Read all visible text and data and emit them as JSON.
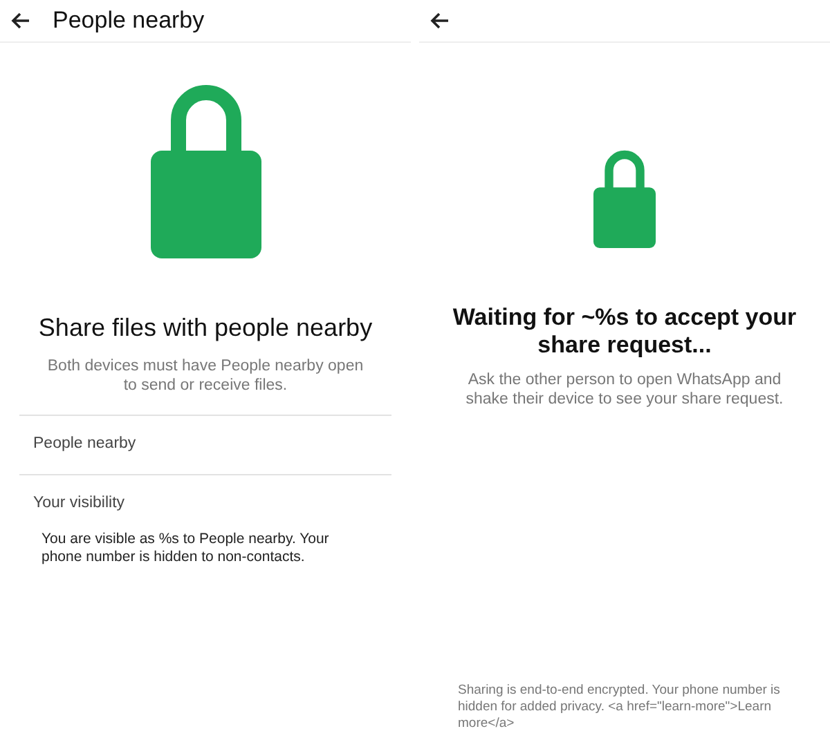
{
  "left_screen": {
    "title": "People nearby",
    "heading": "Share files with people nearby",
    "description": "Both devices must have People nearby open to send or receive files.",
    "sections": [
      {
        "label": "People nearby"
      },
      {
        "label": "Your visibility",
        "text": "You are visible as %s to People nearby. Your phone number is hidden to non-contacts."
      }
    ]
  },
  "right_screen": {
    "heading": "Waiting for ~%s to accept your share request...",
    "description": "Ask the other person to open WhatsApp and shake their device to see your share request.",
    "footer": "Sharing is end-to-end encrypted. Your phone number is hidden for added privacy. <a href=\"learn-more\">Learn more</a>"
  }
}
